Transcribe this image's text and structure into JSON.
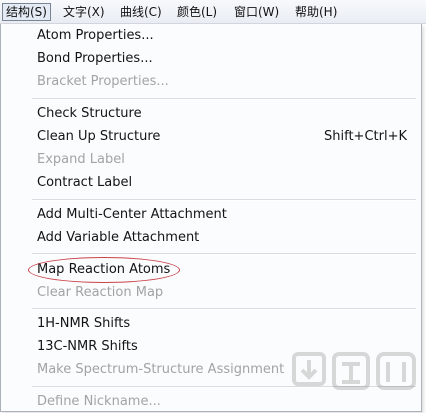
{
  "menubar": {
    "items": [
      {
        "label": "结构(S)",
        "active": true
      },
      {
        "label": "文字(X)"
      },
      {
        "label": "曲线(C)"
      },
      {
        "label": "颜色(L)"
      },
      {
        "label": "窗口(W)"
      },
      {
        "label": "帮助(H)"
      }
    ]
  },
  "menu": {
    "items": [
      {
        "label": "Atom Properties...",
        "enabled": true
      },
      {
        "label": "Bond Properties...",
        "enabled": true
      },
      {
        "label": "Bracket Properties...",
        "enabled": false
      },
      {
        "label": "Check Structure",
        "enabled": true
      },
      {
        "label": "Clean Up Structure",
        "shortcut": "Shift+Ctrl+K",
        "enabled": true
      },
      {
        "label": "Expand Label",
        "enabled": false
      },
      {
        "label": "Contract Label",
        "enabled": true
      },
      {
        "label": "Add Multi-Center Attachment",
        "enabled": true
      },
      {
        "label": "Add Variable Attachment",
        "enabled": true
      },
      {
        "label": "Map Reaction Atoms",
        "enabled": true,
        "circled": true
      },
      {
        "label": "Clear Reaction Map",
        "enabled": false
      },
      {
        "label": "1H-NMR Shifts",
        "enabled": true
      },
      {
        "label": "13C-NMR Shifts",
        "enabled": true
      },
      {
        "label": "Make Spectrum-Structure Assignment",
        "enabled": false
      },
      {
        "label": "Define Nickname...",
        "enabled": false
      }
    ]
  },
  "colors": {
    "annotation_circle": "#c9424a",
    "disabled_text": "#a3a3a3"
  },
  "watermark": {
    "icon": "download-site-logo"
  }
}
